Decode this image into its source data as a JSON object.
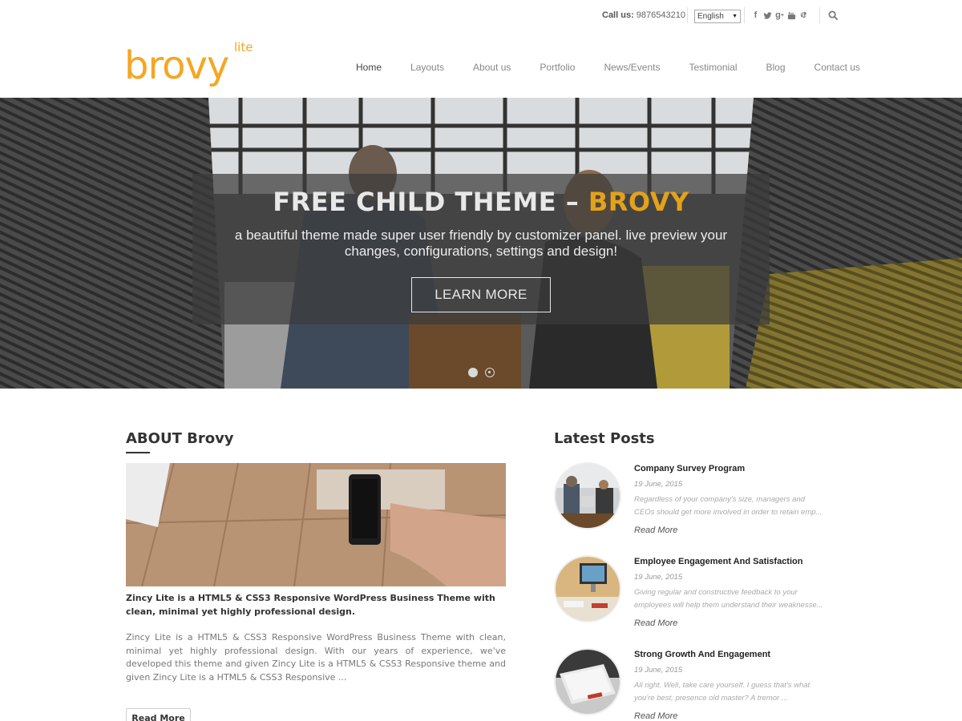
{
  "header": {
    "call_label": "Call us:",
    "call_number": "9876543210",
    "language": {
      "selected": "English"
    },
    "socials": [
      "facebook-icon",
      "twitter-icon",
      "google-plus-icon",
      "youtube-icon",
      "pinterest-icon"
    ],
    "logo": {
      "main": "brovy",
      "tag": "lite",
      "color": "#f5a623"
    }
  },
  "nav": {
    "items": [
      {
        "label": "Home"
      },
      {
        "label": "Layouts"
      },
      {
        "label": "About us"
      },
      {
        "label": "Portfolio"
      },
      {
        "label": "News/Events"
      },
      {
        "label": "Testimonial"
      },
      {
        "label": "Blog"
      },
      {
        "label": "Contact us"
      }
    ]
  },
  "hero": {
    "title_main": "FREE CHILD THEME – ",
    "title_accent": "BROVY",
    "subtitle": "a beautiful theme made super user friendly by customizer panel. live preview your changes, configurations, settings and design!",
    "button": "LEARN MORE",
    "accent_color": "#e3a21a"
  },
  "about": {
    "title": "ABOUT Brovy",
    "lead": "Zincy Lite is a HTML5 & CSS3 Responsive WordPress Business Theme with clean, minimal yet highly professional design.",
    "body": "Zincy Lite is a HTML5 & CSS3 Responsive WordPress Business Theme with clean, minimal yet highly professional design. With our years of experience, we've developed this theme and given Zincy Lite is a HTML5 & CSS3 Responsive theme and given Zincy Lite is a HTML5 & CSS3 Responsive ...",
    "button": "Read More"
  },
  "posts": {
    "title": "Latest Posts",
    "items": [
      {
        "title": "Company Survey Program",
        "date": "19 June, 2015",
        "excerpt": "Regardless of your company's size, managers and CEOs should get more involved in order to retain emp...",
        "more": "Read More"
      },
      {
        "title": "Employee Engagement And Satisfaction",
        "date": "19 June, 2015",
        "excerpt": "Giving regular and constructive feedback to your employees will help them understand their weaknesse...",
        "more": "Read More"
      },
      {
        "title": "Strong Growth And Engagement",
        "date": "19 June, 2015",
        "excerpt": "All right. Well, take care yourself. I guess that's what you're best, presence old master? A tremor ...",
        "more": "Read More"
      }
    ]
  }
}
